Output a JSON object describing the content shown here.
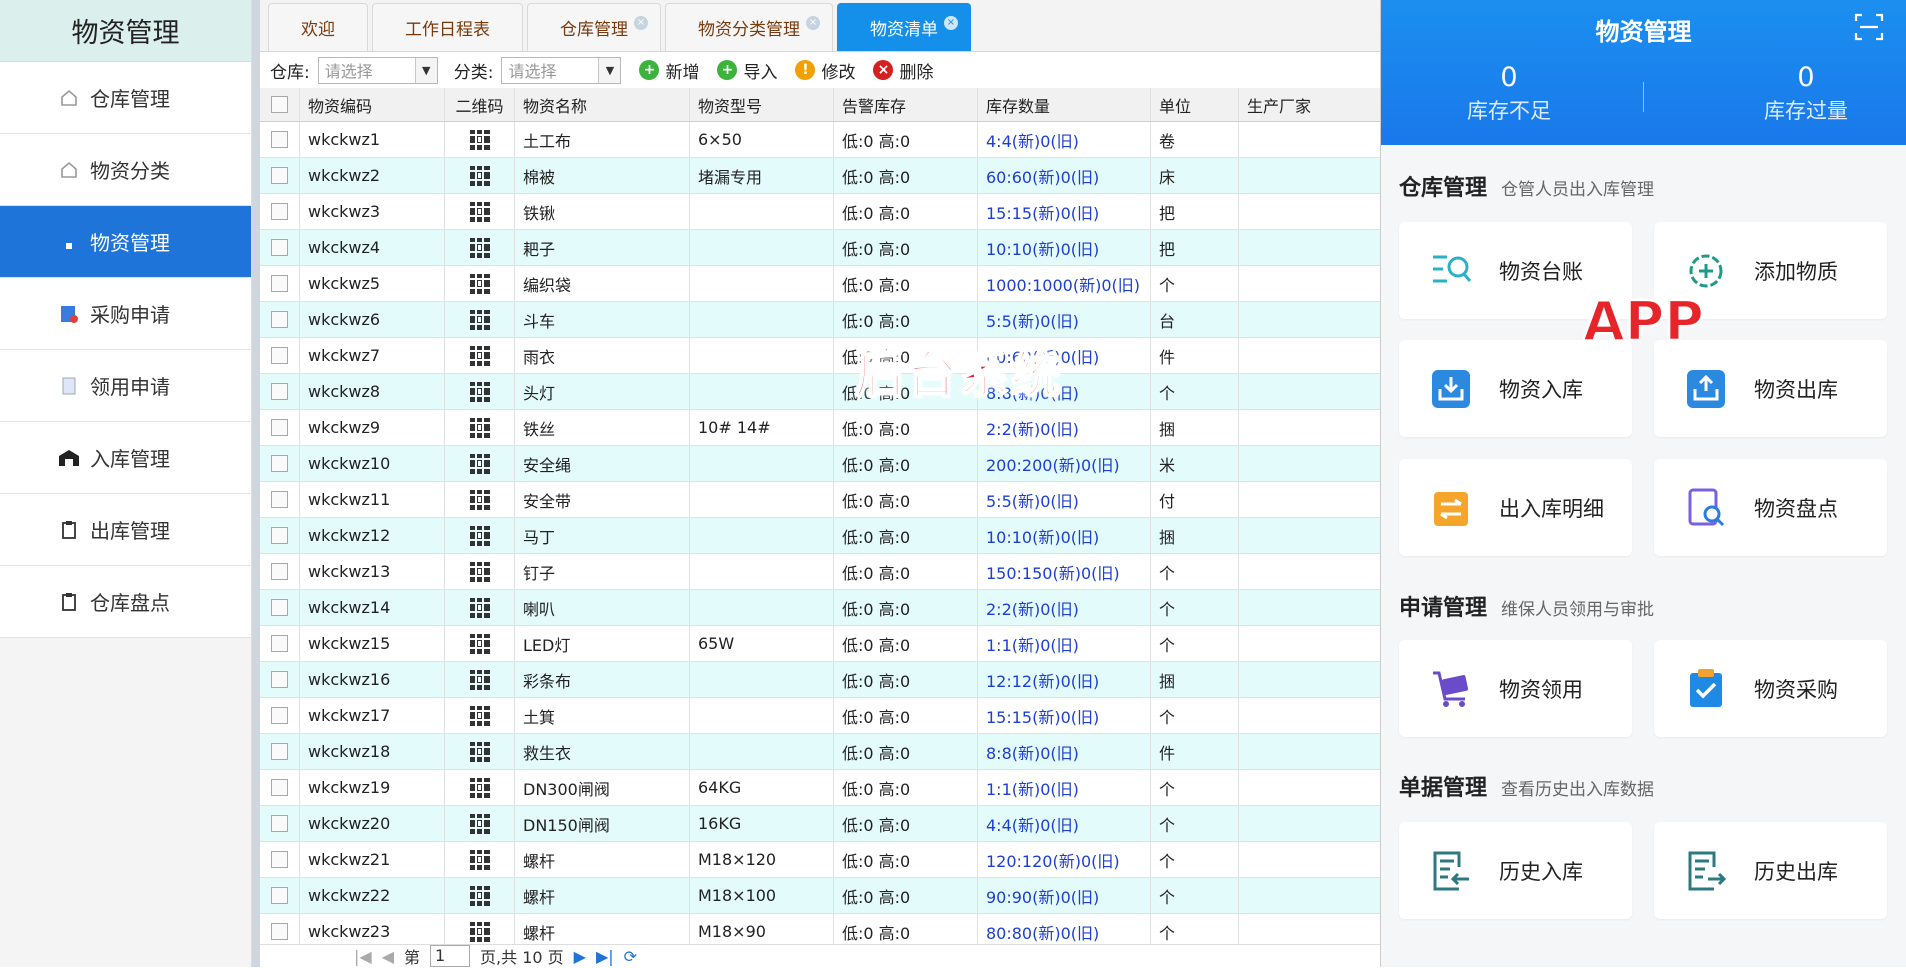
{
  "sidebar": {
    "title": "物资管理",
    "items": [
      {
        "label": "仓库管理",
        "icon": "home-icon"
      },
      {
        "label": "物资分类",
        "icon": "home-icon"
      },
      {
        "label": "物资管理",
        "icon": "warehouse-icon",
        "active": true
      },
      {
        "label": "采购申请",
        "icon": "purchase-form-icon"
      },
      {
        "label": "领用申请",
        "icon": "document-icon"
      },
      {
        "label": "入库管理",
        "icon": "warehouse-in-icon"
      },
      {
        "label": "出库管理",
        "icon": "clipboard-icon"
      },
      {
        "label": "仓库盘点",
        "icon": "clipboard-icon"
      }
    ]
  },
  "tabs": [
    {
      "label": "欢迎",
      "closable": false
    },
    {
      "label": "工作日程表",
      "closable": false
    },
    {
      "label": "仓库管理",
      "closable": true
    },
    {
      "label": "物资分类管理",
      "closable": true
    },
    {
      "label": "物资清单",
      "closable": true,
      "active": true
    }
  ],
  "toolbar": {
    "warehouse_label": "仓库:",
    "warehouse_placeholder": "请选择",
    "category_label": "分类:",
    "category_placeholder": "请选择",
    "add": "新增",
    "import": "导入",
    "edit": "修改",
    "delete": "删除"
  },
  "table": {
    "columns": [
      "物资编码",
      "二维码",
      "物资名称",
      "物资型号",
      "告警库存",
      "库存数量",
      "单位",
      "生产厂家"
    ],
    "rows": [
      [
        "wkckwz1",
        "土工布",
        "6×50",
        "低:0 高:0",
        "4:4(新)0(旧)",
        "卷",
        ""
      ],
      [
        "wkckwz2",
        "棉被",
        "堵漏专用",
        "低:0 高:0",
        "60:60(新)0(旧)",
        "床",
        ""
      ],
      [
        "wkckwz3",
        "铁锹",
        "",
        "低:0 高:0",
        "15:15(新)0(旧)",
        "把",
        ""
      ],
      [
        "wkckwz4",
        "耙子",
        "",
        "低:0 高:0",
        "10:10(新)0(旧)",
        "把",
        ""
      ],
      [
        "wkckwz5",
        "编织袋",
        "",
        "低:0 高:0",
        "1000:1000(新)0(旧)",
        "个",
        ""
      ],
      [
        "wkckwz6",
        "斗车",
        "",
        "低:0 高:0",
        "5:5(新)0(旧)",
        "台",
        ""
      ],
      [
        "wkckwz7",
        "雨衣",
        "",
        "低:0 高:0",
        "60:60(新)0(旧)",
        "件",
        ""
      ],
      [
        "wkckwz8",
        "头灯",
        "",
        "低:0 高:0",
        "8:8(新)0(旧)",
        "个",
        ""
      ],
      [
        "wkckwz9",
        "铁丝",
        "10# 14#",
        "低:0 高:0",
        "2:2(新)0(旧)",
        "捆",
        ""
      ],
      [
        "wkckwz10",
        "安全绳",
        "",
        "低:0 高:0",
        "200:200(新)0(旧)",
        "米",
        ""
      ],
      [
        "wkckwz11",
        "安全带",
        "",
        "低:0 高:0",
        "5:5(新)0(旧)",
        "付",
        ""
      ],
      [
        "wkckwz12",
        "马丁",
        "",
        "低:0 高:0",
        "10:10(新)0(旧)",
        "捆",
        ""
      ],
      [
        "wkckwz13",
        "钉子",
        "",
        "低:0 高:0",
        "150:150(新)0(旧)",
        "个",
        ""
      ],
      [
        "wkckwz14",
        "喇叭",
        "",
        "低:0 高:0",
        "2:2(新)0(旧)",
        "个",
        ""
      ],
      [
        "wkckwz15",
        "LED灯",
        "65W",
        "低:0 高:0",
        "1:1(新)0(旧)",
        "个",
        ""
      ],
      [
        "wkckwz16",
        "彩条布",
        "",
        "低:0 高:0",
        "12:12(新)0(旧)",
        "捆",
        ""
      ],
      [
        "wkckwz17",
        "土箕",
        "",
        "低:0 高:0",
        "15:15(新)0(旧)",
        "个",
        ""
      ],
      [
        "wkckwz18",
        "救生衣",
        "",
        "低:0 高:0",
        "8:8(新)0(旧)",
        "件",
        ""
      ],
      [
        "wkckwz19",
        "DN300闸阀",
        "64KG",
        "低:0 高:0",
        "1:1(新)0(旧)",
        "个",
        ""
      ],
      [
        "wkckwz20",
        "DN150闸阀",
        "16KG",
        "低:0 高:0",
        "4:4(新)0(旧)",
        "个",
        ""
      ],
      [
        "wkckwz21",
        "螺杆",
        "M18×120",
        "低:0 高:0",
        "120:120(新)0(旧)",
        "个",
        ""
      ],
      [
        "wkckwz22",
        "螺杆",
        "M18×100",
        "低:0 高:0",
        "90:90(新)0(旧)",
        "个",
        ""
      ],
      [
        "wkckwz23",
        "螺杆",
        "M18×90",
        "低:0 高:0",
        "80:80(新)0(旧)",
        "个",
        ""
      ]
    ]
  },
  "pager": {
    "prefix": "第",
    "page": "1",
    "suffix": "页,共 10 页"
  },
  "overlay_web": "后台系统",
  "overlay_app": "APP",
  "app": {
    "title": "物资管理",
    "stats": [
      {
        "value": "0",
        "label": "库存不足"
      },
      {
        "value": "0",
        "label": "库存过量"
      }
    ],
    "sections": [
      {
        "title": "仓库管理",
        "subtitle": "仓管人员出入库管理",
        "cards": [
          {
            "label": "物资台账",
            "icon": "ledger-search-icon"
          },
          {
            "label": "添加物质",
            "icon": "add-gear-icon"
          },
          {
            "label": "物资入库",
            "icon": "inbox-in-icon"
          },
          {
            "label": "物资出库",
            "icon": "inbox-out-icon"
          },
          {
            "label": "出入库明细",
            "icon": "transfer-list-icon"
          },
          {
            "label": "物资盘点",
            "icon": "inventory-search-icon"
          }
        ]
      },
      {
        "title": "申请管理",
        "subtitle": "维保人员领用与审批",
        "cards": [
          {
            "label": "物资领用",
            "icon": "cart-icon"
          },
          {
            "label": "物资采购",
            "icon": "checklist-icon"
          }
        ]
      },
      {
        "title": "单据管理",
        "subtitle": "查看历史出入库数据",
        "cards": [
          {
            "label": "历史入库",
            "icon": "history-in-icon"
          },
          {
            "label": "历史出库",
            "icon": "history-out-icon"
          }
        ]
      }
    ]
  },
  "colors": {
    "accent": "#1e74d8",
    "tab_active": "#1590ea",
    "row_alt": "#e4fbfb",
    "qty_text": "#1c3fd1",
    "overlay": "#e8242b"
  }
}
